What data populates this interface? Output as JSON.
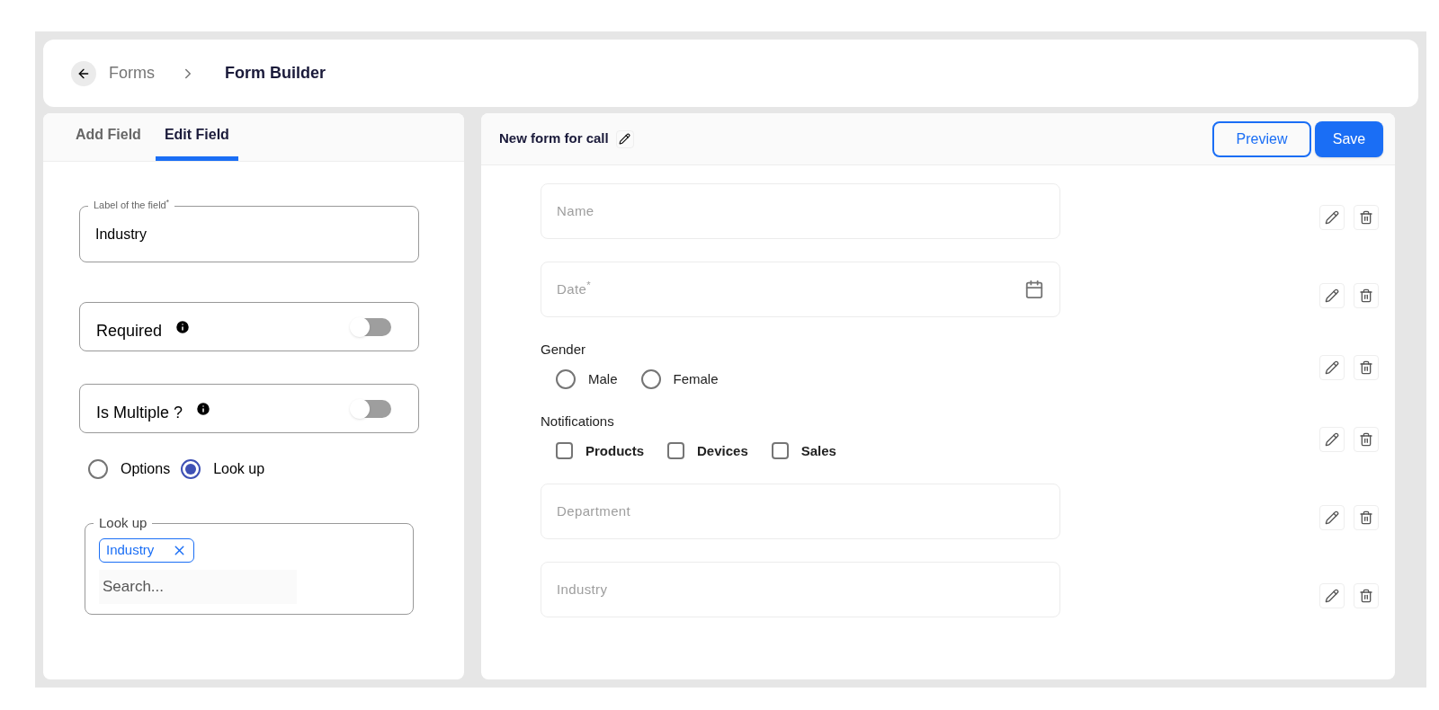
{
  "breadcrumb": {
    "parent": "Forms",
    "current": "Form Builder"
  },
  "tabs": [
    {
      "label": "Add Field",
      "selected": false
    },
    {
      "label": "Edit Field",
      "selected": true
    }
  ],
  "edit_field": {
    "label_field": {
      "label": "Label of the field$^{*}$",
      "value": "Industry"
    },
    "toggles": [
      {
        "label": "Required",
        "on": false
      },
      {
        "label": "Is Multiple ?",
        "on": false
      }
    ],
    "source": [
      {
        "label": "Options",
        "selected": false
      },
      {
        "label": "Look up",
        "selected": true
      }
    ],
    "lookup": {
      "label": "Look up",
      "chips": [
        "Industry"
      ],
      "placeholder": "Search..."
    }
  },
  "form": {
    "title": "New form for call",
    "buttons": {
      "preview": "Preview",
      "save": "Save"
    },
    "fields": [
      {
        "kind": "text",
        "placeholder": "Name"
      },
      {
        "kind": "date",
        "placeholder": "Date$^{*}$"
      },
      {
        "kind": "radio",
        "label": "Gender",
        "options": [
          {
            "label": "Male",
            "selected": false
          },
          {
            "label": "Female",
            "selected": false
          }
        ]
      },
      {
        "kind": "checkbox",
        "label": "Notifications",
        "options": [
          {
            "label": "Products",
            "checked": false
          },
          {
            "label": "Devices",
            "checked": false
          },
          {
            "label": "Sales",
            "checked": false
          }
        ]
      },
      {
        "kind": "text",
        "placeholder": "Department"
      },
      {
        "kind": "text",
        "placeholder": "Industry"
      }
    ]
  }
}
